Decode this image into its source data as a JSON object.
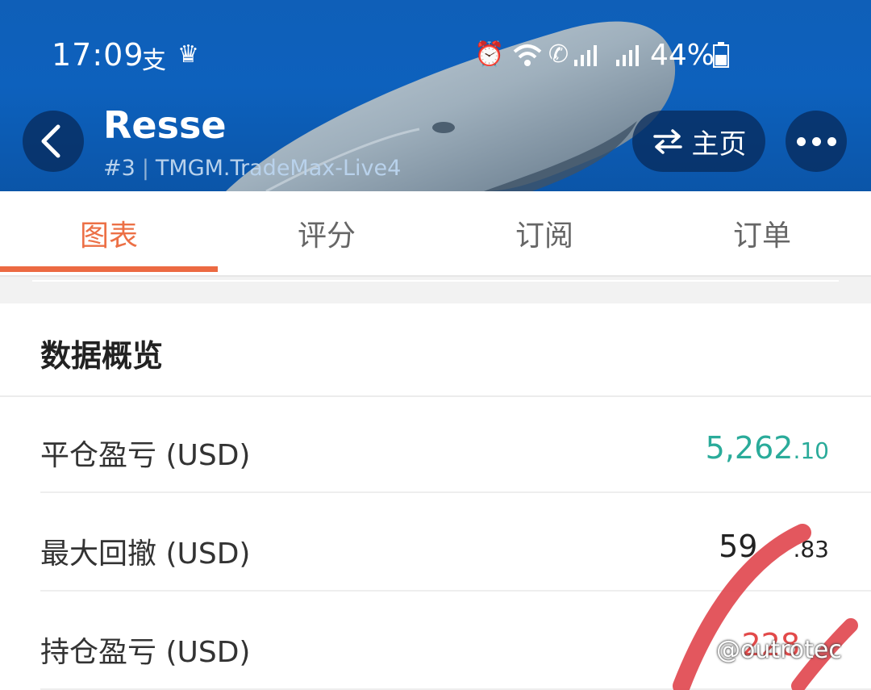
{
  "status_bar": {
    "time": "17:09",
    "left_icons": [
      "alipay-icon",
      "app-icon"
    ],
    "right_icons": [
      "alarm-icon",
      "wifi-icon",
      "call-signal-icon",
      "signal-icon"
    ],
    "battery": "44%"
  },
  "header": {
    "title": "Resse",
    "rank": "#3",
    "server": "TMGM.TradeMax-Live4",
    "home_label": "主页",
    "colors": {
      "bg": "#0d61bd",
      "button_bg": "#072a5a"
    }
  },
  "tabs": [
    {
      "label": "图表",
      "active": true
    },
    {
      "label": "评分",
      "active": false
    },
    {
      "label": "订阅",
      "active": false
    },
    {
      "label": "订单",
      "active": false
    }
  ],
  "accent_color": "#ec6a42",
  "overview": {
    "title": "数据概览",
    "rows": [
      {
        "label": "平仓盈亏 (USD)",
        "value_int": "5,262",
        "value_dec": ".10",
        "color": "#2aab9a"
      },
      {
        "label": "最大回撤 (USD)",
        "value_int": "59",
        "value_dec": ".83",
        "color": "#222222"
      },
      {
        "label": "持仓盈亏 (USD)",
        "value_int": "228",
        "value_dec": "",
        "color": "#e24a4a"
      }
    ]
  },
  "watermark": "@outrotec"
}
